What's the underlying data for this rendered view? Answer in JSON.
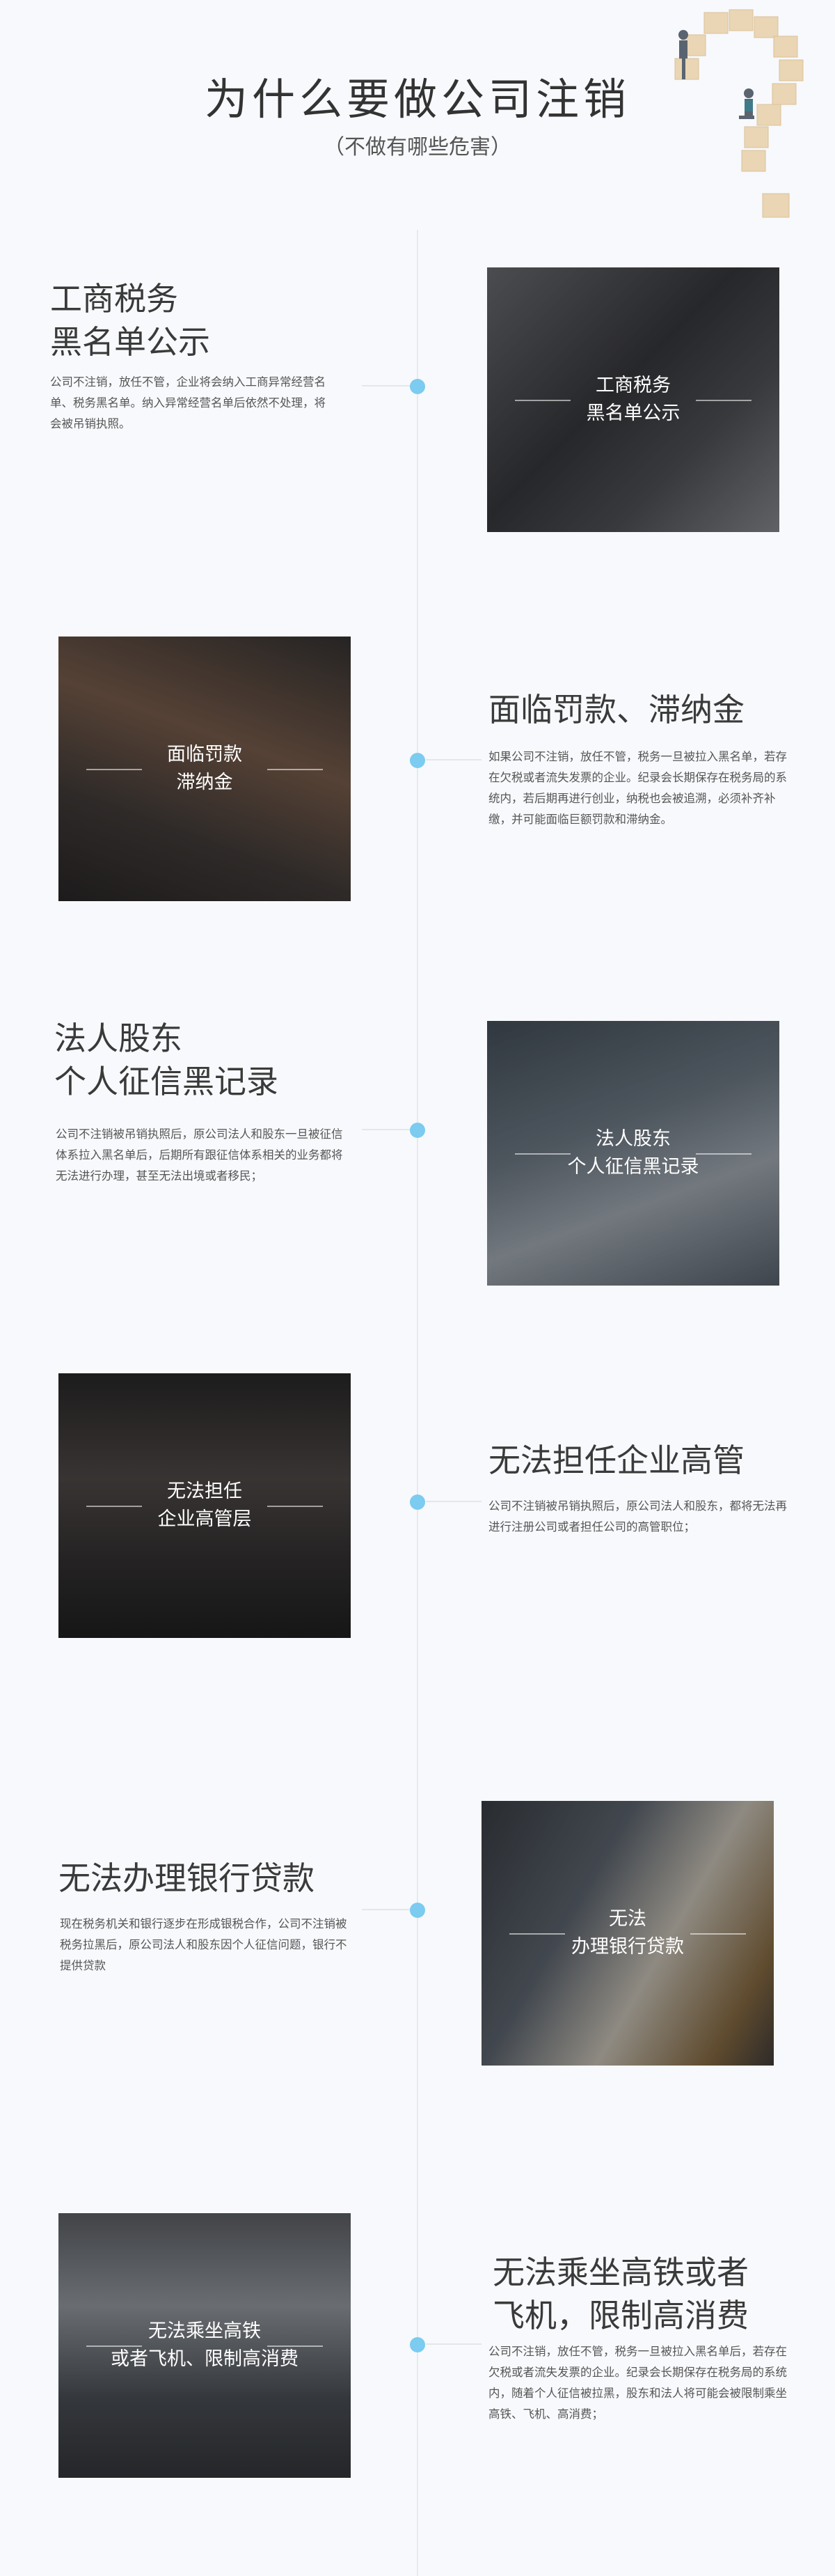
{
  "header": {
    "title": "为什么要做公司注销",
    "subtitle": "（不做有哪些危害）"
  },
  "items": [
    {
      "heading_line1": "工商税务",
      "heading_line2": "黑名单公示",
      "desc": "公司不注销，放任不管，企业将会纳入工商异常经营名单、税务黑名单。纳入异常经营名单后依然不处理，将会被吊销执照。",
      "photo_line1": "工商税务",
      "photo_line2": "黑名单公示"
    },
    {
      "heading_line1": "面临罚款、滞纳金",
      "heading_line2": "",
      "desc": "如果公司不注销，放任不管，税务一旦被拉入黑名单，若存在欠税或者流失发票的企业。纪录会长期保存在税务局的系统内，若后期再进行创业，纳税也会被追溯，必须补齐补缴，并可能面临巨额罚款和滞纳金。",
      "photo_line1": "面临罚款",
      "photo_line2": "滞纳金"
    },
    {
      "heading_line1": "法人股东",
      "heading_line2": "个人征信黑记录",
      "desc": "公司不注销被吊销执照后，原公司法人和股东一旦被征信体系拉入黑名单后，后期所有跟征信体系相关的业务都将无法进行办理，甚至无法出境或者移民；",
      "photo_line1": "法人股东",
      "photo_line2": "个人征信黑记录"
    },
    {
      "heading_line1": "无法担任企业高管",
      "heading_line2": "",
      "desc": "公司不注销被吊销执照后，原公司法人和股东，都将无法再进行注册公司或者担任公司的高管职位；",
      "photo_line1": "无法担任",
      "photo_line2": "企业高管层"
    },
    {
      "heading_line1": "无法办理银行贷款",
      "heading_line2": "",
      "desc": "现在税务机关和银行逐步在形成银税合作，公司不注销被税务拉黑后，原公司法人和股东因个人征信问题，银行不提供贷款",
      "photo_line1": "无法",
      "photo_line2": "办理银行贷款"
    },
    {
      "heading_line1": "无法乘坐高铁或者",
      "heading_line2": "飞机，限制高消费",
      "desc": "公司不注销，放任不管，税务一旦被拉入黑名单后，若存在欠税或者流失发票的企业。纪录会长期保存在税务局的系统内，随着个人征信被拉黑，股东和法人将可能会被限制乘坐高铁、飞机、高消费；",
      "photo_line1": "无法乘坐高铁",
      "photo_line2": "或者飞机、限制高消费"
    }
  ]
}
